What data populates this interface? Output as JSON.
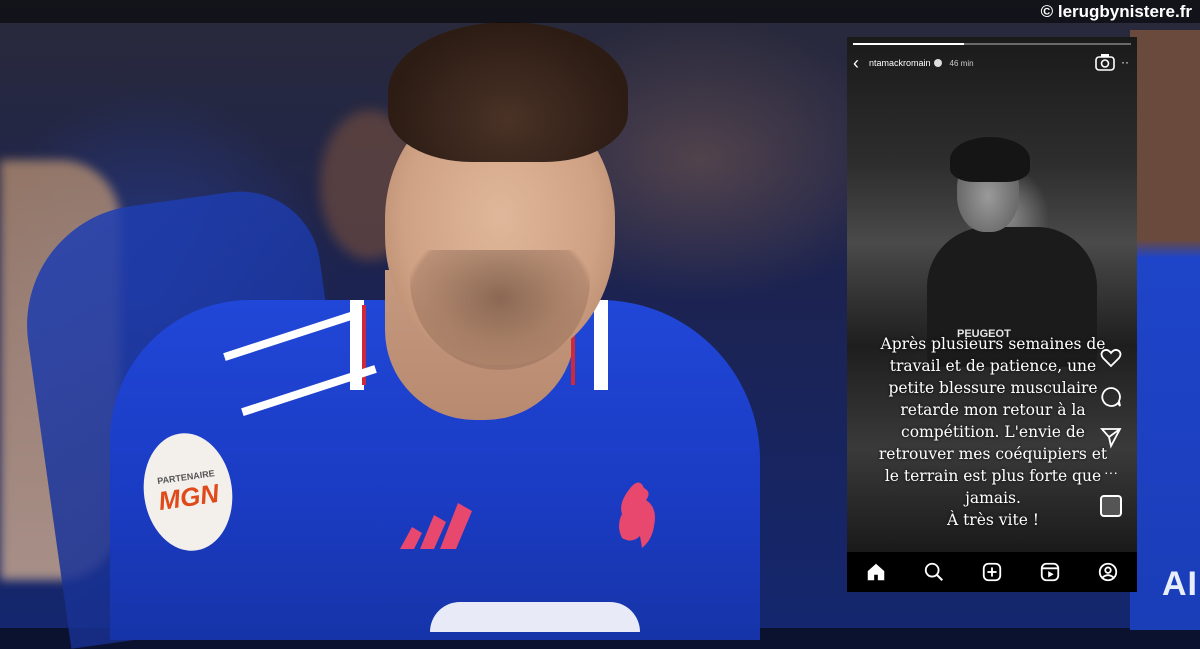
{
  "watermark": "© lerugbynistere.fr",
  "background": {
    "sponsor_badge_small": "PARTENAIRE",
    "sponsor_badge_big": "MGN",
    "right_edge_text": "AI"
  },
  "story": {
    "username": "ntamackromain",
    "time": "46 min",
    "sponsor_text": "PEUGEOT",
    "caption_lines": [
      "Après plusieurs semaines de",
      "travail et de patience, une",
      "petite blessure musculaire",
      "retarde mon retour à la",
      "compétition. L'envie de",
      "retrouver mes coéquipiers et",
      "le terrain est plus forte que",
      "jamais.",
      "À très vite !"
    ],
    "side_actions": [
      "heart-icon",
      "comment-icon",
      "share-icon",
      "more-icon",
      "avatar"
    ],
    "nav": [
      "home-icon",
      "search-icon",
      "add-icon",
      "reels-icon",
      "profile-icon"
    ]
  },
  "colors": {
    "jersey_blue": "#1f45d2",
    "accent_red": "#d0283b",
    "story_bg": "#000000"
  }
}
